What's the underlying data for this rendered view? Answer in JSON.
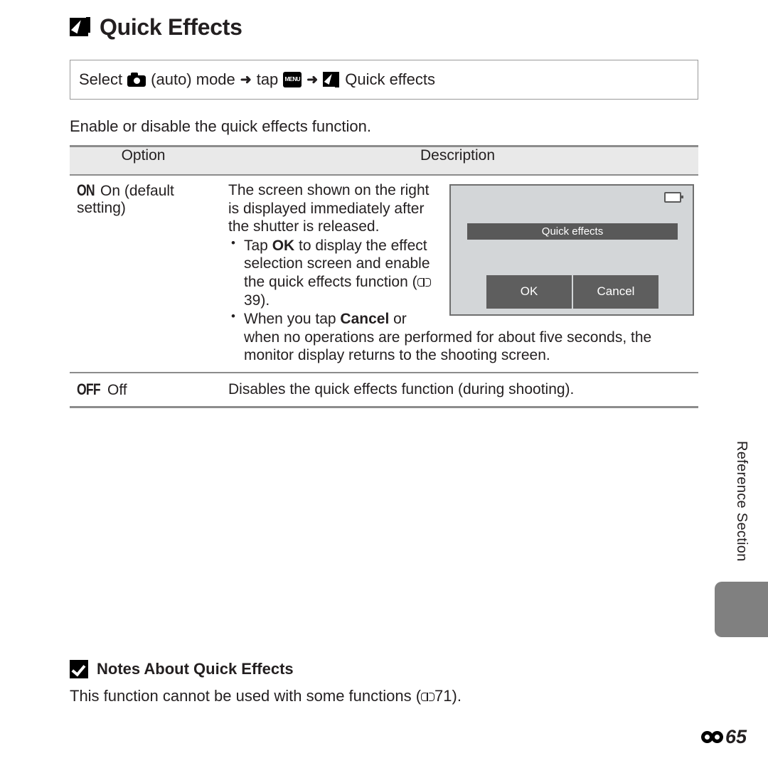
{
  "page": {
    "title": "Quick Effects",
    "title_icon": "quick-effects-icon",
    "number_label": "65",
    "number_icon": "reference-symbol-icon"
  },
  "nav_path": {
    "select_word": "Select",
    "camera_icon": "camera-auto-mode-icon",
    "auto_label": "(auto) mode",
    "arrow1": "➜",
    "tap_word": "tap",
    "menu_icon": "menu-button-icon",
    "menu_label": "MENU",
    "arrow2": "➜",
    "quick_effects_icon": "quick-effects-icon",
    "destination": "Quick effects"
  },
  "intro_text": "Enable or disable the quick effects function.",
  "table": {
    "headers": [
      "Option",
      "Description"
    ],
    "rows": [
      {
        "option_glyph": "ON",
        "option_label": "On (default setting)",
        "description_intro": "The screen shown on the right is displayed immediately after the shutter is released.",
        "bullets": [
          {
            "pre": "Tap ",
            "bold": "OK",
            "post": " to display the effect selection screen and enable the quick effects function (",
            "ref": "39",
            "tail": ")."
          },
          {
            "pre": "When you tap ",
            "bold": "Cancel",
            "post": " or when no operations are performed for about five seconds, the monitor display returns to the shooting screen.",
            "ref": "",
            "tail": ""
          }
        ]
      },
      {
        "option_glyph": "OFF",
        "option_label": "Off",
        "description_intro": "Disables the quick effects function (during shooting).",
        "bullets": []
      }
    ]
  },
  "camera_screen": {
    "battery_icon": "battery-icon",
    "title_bar": "Quick effects",
    "ok_button": "OK",
    "cancel_button": "Cancel"
  },
  "side_tab": {
    "label": "Reference Section",
    "tab_color": "#808080"
  },
  "notes": {
    "icon": "checkmark-note-icon",
    "title": "Notes About Quick Effects",
    "body_pre": "This function cannot be used with some functions (",
    "body_ref": "71",
    "body_tail": ")."
  }
}
